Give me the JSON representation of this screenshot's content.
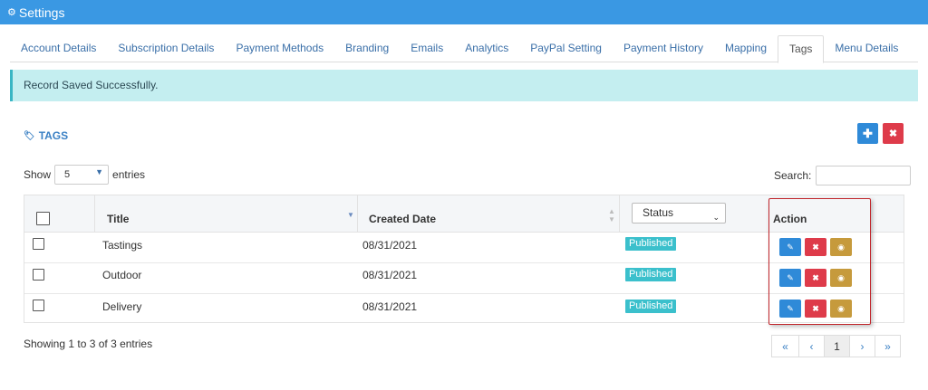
{
  "header": {
    "title": "Settings",
    "icon": "gear-icon"
  },
  "tabs": [
    {
      "label": "Account Details"
    },
    {
      "label": "Subscription Details"
    },
    {
      "label": "Payment Methods"
    },
    {
      "label": "Branding"
    },
    {
      "label": "Emails"
    },
    {
      "label": "Analytics"
    },
    {
      "label": "PayPal Setting"
    },
    {
      "label": "Payment History"
    },
    {
      "label": "Mapping"
    },
    {
      "label": "Tags",
      "active": true
    },
    {
      "label": "Menu Details"
    }
  ],
  "alert": {
    "message": "Record Saved Successfully."
  },
  "section": {
    "title": "TAGS",
    "icon": "tag-icon"
  },
  "controls": {
    "show_label": "Show",
    "page_size": "5",
    "entries_label": "entries",
    "search_label": "Search:",
    "search_value": ""
  },
  "table": {
    "columns": {
      "title": "Title",
      "created": "Created Date",
      "status": "Status",
      "action": "Action"
    },
    "rows": [
      {
        "title": "Tastings",
        "created": "08/31/2021",
        "status": "Published"
      },
      {
        "title": "Outdoor",
        "created": "08/31/2021",
        "status": "Published"
      },
      {
        "title": "Delivery",
        "created": "08/31/2021",
        "status": "Published"
      }
    ]
  },
  "footer": {
    "info": "Showing 1 to 3 of 3 entries",
    "pager": {
      "first": "«",
      "prev": "‹",
      "current": "1",
      "next": "›",
      "last": "»"
    }
  },
  "colors": {
    "topbar": "#3a98e3",
    "alert_bg": "#c4eef0",
    "badge": "#3bc0cc",
    "edit": "#2f8ad8",
    "delete": "#de3b4a",
    "view": "#c69a3c",
    "highlight": "#c0252b"
  }
}
